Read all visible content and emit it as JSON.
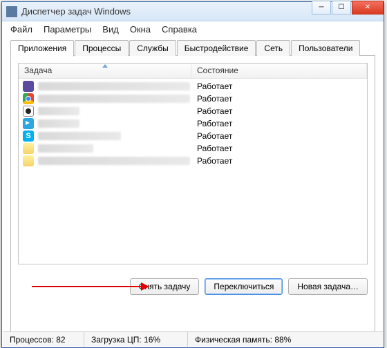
{
  "window": {
    "title": "Диспетчер задач Windows"
  },
  "menu": {
    "file": "Файл",
    "options": "Параметры",
    "view": "Вид",
    "windows": "Окна",
    "help": "Справка"
  },
  "tabs": {
    "apps": "Приложения",
    "processes": "Процессы",
    "services": "Службы",
    "performance": "Быстродействие",
    "network": "Сеть",
    "users": "Пользователи"
  },
  "columns": {
    "task": "Задача",
    "state": "Состояние"
  },
  "rows": [
    {
      "state": "Работает"
    },
    {
      "state": "Работает"
    },
    {
      "state": "Работает"
    },
    {
      "state": "Работает"
    },
    {
      "state": "Работает"
    },
    {
      "state": "Работает"
    },
    {
      "state": "Работает"
    }
  ],
  "buttons": {
    "end": "Снять задачу",
    "switch": "Переключиться",
    "new": "Новая задача…"
  },
  "status": {
    "processes": "Процессов: 82",
    "cpu": "Загрузка ЦП: 16%",
    "mem": "Физическая память: 88%"
  }
}
